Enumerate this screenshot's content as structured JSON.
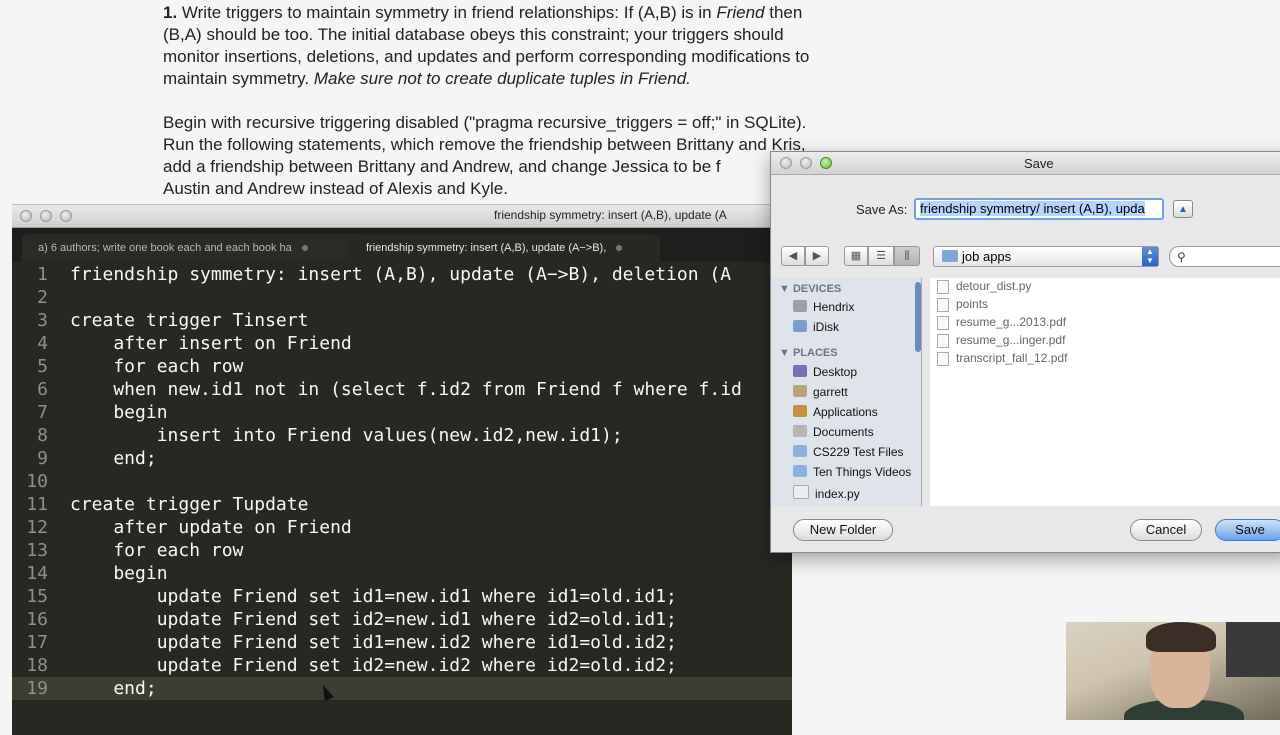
{
  "document": {
    "para1_number": "1.",
    "para1_part1": " Write triggers to maintain symmetry in friend relationships: If (A,B) is in ",
    "para1_friend": "Friend",
    "para1_part2": " then\n(B,A) should be too. The initial database obeys this constraint; your triggers should\nmonitor insertions, deletions, and updates and perform corresponding modifications to\nmaintain symmetry. ",
    "para1_italic": "Make sure not to create duplicate tuples in Friend.",
    "para2": "Begin with recursive triggering disabled (\"pragma recursive_triggers = off;\" in SQLite).\nRun the following statements, which remove the friendship between Brittany and Kris,\nadd a friendship between Brittany and Andrew, and change Jessica to be f\nAustin and Andrew instead of Alexis and Kyle."
  },
  "editor": {
    "window_title": "friendship symmetry: insert (A,B), update (A",
    "tabs": [
      {
        "label": "a) 6 authors; write one book each and each book ha"
      },
      {
        "label": "friendship symmetry: insert (A,B), update (A−>B),"
      }
    ],
    "current_line": 19,
    "lines": [
      {
        "n": "1",
        "text": "friendship symmetry: insert (A,B), update (A−>B), deletion (A"
      },
      {
        "n": "2",
        "text": ""
      },
      {
        "n": "3",
        "text": "create trigger Tinsert"
      },
      {
        "n": "4",
        "text": "    after insert on Friend"
      },
      {
        "n": "5",
        "text": "    for each row"
      },
      {
        "n": "6",
        "text": "    when new.id1 not in (select f.id2 from Friend f where f.id"
      },
      {
        "n": "7",
        "text": "    begin"
      },
      {
        "n": "8",
        "text": "        insert into Friend values(new.id2,new.id1);"
      },
      {
        "n": "9",
        "text": "    end;"
      },
      {
        "n": "10",
        "text": ""
      },
      {
        "n": "11",
        "text": "create trigger Tupdate"
      },
      {
        "n": "12",
        "text": "    after update on Friend"
      },
      {
        "n": "13",
        "text": "    for each row"
      },
      {
        "n": "14",
        "text": "    begin"
      },
      {
        "n": "15",
        "text": "        update Friend set id1=new.id1 where id1=old.id1;"
      },
      {
        "n": "16",
        "text": "        update Friend set id2=new.id1 where id2=old.id1;"
      },
      {
        "n": "17",
        "text": "        update Friend set id1=new.id2 where id1=old.id2;"
      },
      {
        "n": "18",
        "text": "        update Friend set id2=new.id2 where id2=old.id2;"
      },
      {
        "n": "19",
        "text": "    end;"
      }
    ]
  },
  "save_dialog": {
    "title": "Save",
    "save_as_label": "Save As:",
    "save_as_value": "friendship symmetry/ insert (A,B), upda",
    "location": "job apps",
    "devices_header": "DEVICES",
    "places_header": "PLACES",
    "devices": [
      {
        "label": "Hendrix",
        "icon": "hard-drive-icon"
      },
      {
        "label": "iDisk",
        "icon": "idisk-icon"
      }
    ],
    "places": [
      {
        "label": "Desktop",
        "icon": "desktop-icon"
      },
      {
        "label": "garrett",
        "icon": "home-icon"
      },
      {
        "label": "Applications",
        "icon": "applications-icon"
      },
      {
        "label": "Documents",
        "icon": "documents-icon"
      },
      {
        "label": "CS229 Test Files",
        "icon": "folder-icon"
      },
      {
        "label": "Ten Things Videos",
        "icon": "folder-icon"
      },
      {
        "label": "index.py",
        "icon": "file-icon"
      }
    ],
    "files": [
      "detour_dist.py",
      "points",
      "resume_g...2013.pdf",
      "resume_g...inger.pdf",
      "transcript_fall_12.pdf"
    ],
    "new_folder_label": "New Folder",
    "cancel_label": "Cancel",
    "save_label": "Save"
  }
}
